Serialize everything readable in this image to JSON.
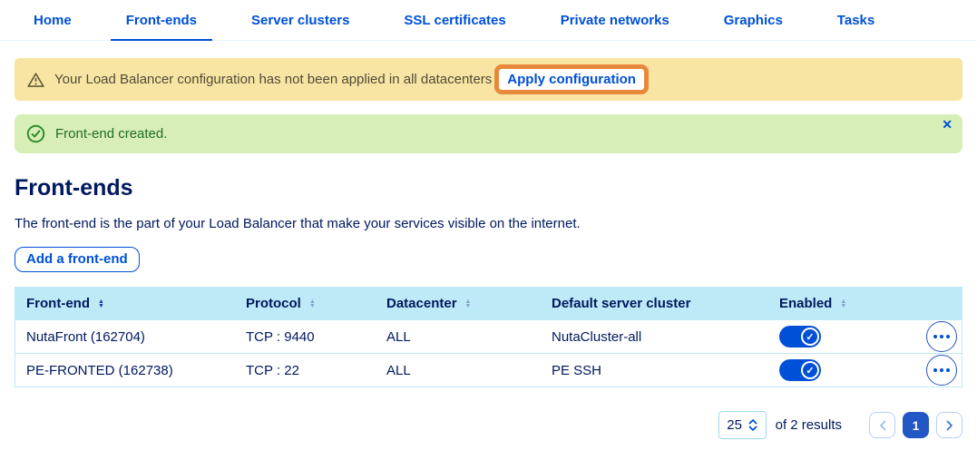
{
  "colors": {
    "accent_blue": "#0050d7",
    "navy_text": "#00185e",
    "table_header_bg": "#bee9f7",
    "warning_bg": "#f9e5a3",
    "success_bg": "#d7eeb6",
    "annotation_orange": "#e8883a",
    "active_page_bg": "#2257c5"
  },
  "tabs": [
    {
      "label": "Home",
      "active": false
    },
    {
      "label": "Front-ends",
      "active": true
    },
    {
      "label": "Server clusters",
      "active": false
    },
    {
      "label": "SSL certificates",
      "active": false
    },
    {
      "label": "Private networks",
      "active": false
    },
    {
      "label": "Graphics",
      "active": false
    },
    {
      "label": "Tasks",
      "active": false
    }
  ],
  "warning_banner": {
    "icon": "warning-triangle-icon",
    "text": "Your Load Balancer configuration has not been applied in all datacenters",
    "action_label": "Apply configuration"
  },
  "success_banner": {
    "icon": "check-circle-icon",
    "text": "Front-end created."
  },
  "page": {
    "title": "Front-ends",
    "description": "The front-end is the part of your Load Balancer that make your services visible on the internet.",
    "add_button_label": "Add a front-end"
  },
  "table": {
    "columns": [
      {
        "label": "Front-end",
        "sortable": true
      },
      {
        "label": "Protocol",
        "sortable": true
      },
      {
        "label": "Datacenter",
        "sortable": true
      },
      {
        "label": "Default server cluster",
        "sortable": false
      },
      {
        "label": "Enabled",
        "sortable": true
      }
    ],
    "rows": [
      {
        "front_end": "NutaFront (162704)",
        "protocol": "TCP : 9440",
        "datacenter": "ALL",
        "default_server_cluster": "NutaCluster-all",
        "enabled": true
      },
      {
        "front_end": "PE-FRONTED (162738)",
        "protocol": "TCP : 22",
        "datacenter": "ALL",
        "default_server_cluster": "PE SSH",
        "enabled": true
      }
    ]
  },
  "pagination": {
    "page_size": "25",
    "results_text": "of 2 results",
    "current_page": "1"
  },
  "icons": {
    "sort_asc": "▲",
    "sort_desc": "▼",
    "check": "✓",
    "close": "✕"
  }
}
